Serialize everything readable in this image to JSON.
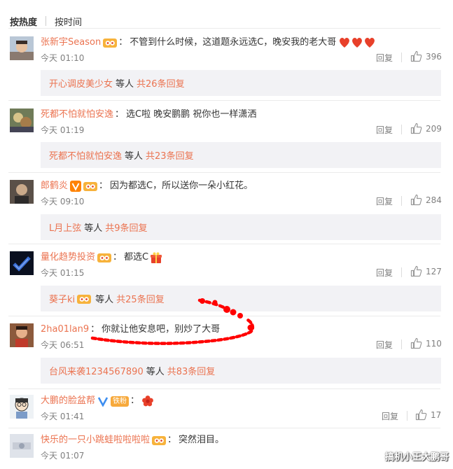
{
  "sort": {
    "hot_label": "按热度",
    "time_label": "按时间"
  },
  "comments": [
    {
      "name": "张新宇Season",
      "text": "不管到什么时候，这道题永远选C，晚安我的老大哥",
      "time": "今天 01:10",
      "reply": "回复",
      "likes": "396",
      "sub_name": "开心调皮美少女",
      "sub_etc": "等人",
      "sub_total": "共26条回复"
    },
    {
      "name": "死都不怕就怕安逸",
      "text": "选C啦 晚安鹏鹏 祝你也一样潇洒",
      "time": "今天 01:19",
      "reply": "回复",
      "likes": "209",
      "sub_name": "死都不怕就怕安逸",
      "sub_etc": "等人",
      "sub_total": "共23条回复"
    },
    {
      "name": "郎鹤炎",
      "text": "因为都选C，所以送你一朵小红花。",
      "time": "今天 09:10",
      "reply": "回复",
      "likes": "284",
      "sub_name": "L月上弦",
      "sub_etc": "等人",
      "sub_total": "共9条回复"
    },
    {
      "name": "量化趋势投资",
      "text": "都选C",
      "time": "今天 01:15",
      "reply": "回复",
      "likes": "127",
      "sub_name": "葵子ki",
      "sub_etc": "等人",
      "sub_total": "共25条回复"
    },
    {
      "name": "2ha01lan9",
      "text": "你就让他安息吧，别炒了大哥",
      "time": "今天 06:51",
      "reply": "回复",
      "likes": "110",
      "sub_name": "台风来袭1234567890",
      "sub_etc": "等人",
      "sub_total": "共83条回复"
    },
    {
      "name": "大鹏的脸盆帮",
      "text": "",
      "time": "今天 01:41",
      "reply": "回复",
      "likes": "17",
      "badge_text": "铁粉"
    },
    {
      "name": "快乐的一只小跳蛙啦啦啦啦",
      "text": "突然泪目。",
      "time": "今天 01:07"
    }
  ],
  "watermark": "搞机小王大鹏哥",
  "colors": {
    "accent": "#eb7350",
    "subbg": "#f2f2f5",
    "annotation": "#ff0000"
  }
}
